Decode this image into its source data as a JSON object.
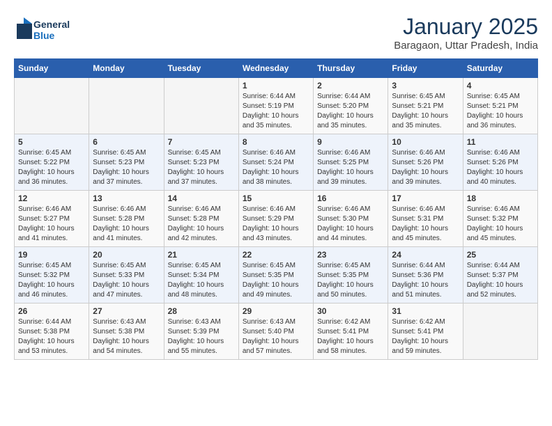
{
  "header": {
    "logo_line1": "General",
    "logo_line2": "Blue",
    "month": "January 2025",
    "location": "Baragaon, Uttar Pradesh, India"
  },
  "days_of_week": [
    "Sunday",
    "Monday",
    "Tuesday",
    "Wednesday",
    "Thursday",
    "Friday",
    "Saturday"
  ],
  "weeks": [
    [
      {
        "num": "",
        "info": ""
      },
      {
        "num": "",
        "info": ""
      },
      {
        "num": "",
        "info": ""
      },
      {
        "num": "1",
        "info": "Sunrise: 6:44 AM\nSunset: 5:19 PM\nDaylight: 10 hours\nand 35 minutes."
      },
      {
        "num": "2",
        "info": "Sunrise: 6:44 AM\nSunset: 5:20 PM\nDaylight: 10 hours\nand 35 minutes."
      },
      {
        "num": "3",
        "info": "Sunrise: 6:45 AM\nSunset: 5:21 PM\nDaylight: 10 hours\nand 35 minutes."
      },
      {
        "num": "4",
        "info": "Sunrise: 6:45 AM\nSunset: 5:21 PM\nDaylight: 10 hours\nand 36 minutes."
      }
    ],
    [
      {
        "num": "5",
        "info": "Sunrise: 6:45 AM\nSunset: 5:22 PM\nDaylight: 10 hours\nand 36 minutes."
      },
      {
        "num": "6",
        "info": "Sunrise: 6:45 AM\nSunset: 5:23 PM\nDaylight: 10 hours\nand 37 minutes."
      },
      {
        "num": "7",
        "info": "Sunrise: 6:45 AM\nSunset: 5:23 PM\nDaylight: 10 hours\nand 37 minutes."
      },
      {
        "num": "8",
        "info": "Sunrise: 6:46 AM\nSunset: 5:24 PM\nDaylight: 10 hours\nand 38 minutes."
      },
      {
        "num": "9",
        "info": "Sunrise: 6:46 AM\nSunset: 5:25 PM\nDaylight: 10 hours\nand 39 minutes."
      },
      {
        "num": "10",
        "info": "Sunrise: 6:46 AM\nSunset: 5:26 PM\nDaylight: 10 hours\nand 39 minutes."
      },
      {
        "num": "11",
        "info": "Sunrise: 6:46 AM\nSunset: 5:26 PM\nDaylight: 10 hours\nand 40 minutes."
      }
    ],
    [
      {
        "num": "12",
        "info": "Sunrise: 6:46 AM\nSunset: 5:27 PM\nDaylight: 10 hours\nand 41 minutes."
      },
      {
        "num": "13",
        "info": "Sunrise: 6:46 AM\nSunset: 5:28 PM\nDaylight: 10 hours\nand 41 minutes."
      },
      {
        "num": "14",
        "info": "Sunrise: 6:46 AM\nSunset: 5:28 PM\nDaylight: 10 hours\nand 42 minutes."
      },
      {
        "num": "15",
        "info": "Sunrise: 6:46 AM\nSunset: 5:29 PM\nDaylight: 10 hours\nand 43 minutes."
      },
      {
        "num": "16",
        "info": "Sunrise: 6:46 AM\nSunset: 5:30 PM\nDaylight: 10 hours\nand 44 minutes."
      },
      {
        "num": "17",
        "info": "Sunrise: 6:46 AM\nSunset: 5:31 PM\nDaylight: 10 hours\nand 45 minutes."
      },
      {
        "num": "18",
        "info": "Sunrise: 6:46 AM\nSunset: 5:32 PM\nDaylight: 10 hours\nand 45 minutes."
      }
    ],
    [
      {
        "num": "19",
        "info": "Sunrise: 6:45 AM\nSunset: 5:32 PM\nDaylight: 10 hours\nand 46 minutes."
      },
      {
        "num": "20",
        "info": "Sunrise: 6:45 AM\nSunset: 5:33 PM\nDaylight: 10 hours\nand 47 minutes."
      },
      {
        "num": "21",
        "info": "Sunrise: 6:45 AM\nSunset: 5:34 PM\nDaylight: 10 hours\nand 48 minutes."
      },
      {
        "num": "22",
        "info": "Sunrise: 6:45 AM\nSunset: 5:35 PM\nDaylight: 10 hours\nand 49 minutes."
      },
      {
        "num": "23",
        "info": "Sunrise: 6:45 AM\nSunset: 5:35 PM\nDaylight: 10 hours\nand 50 minutes."
      },
      {
        "num": "24",
        "info": "Sunrise: 6:44 AM\nSunset: 5:36 PM\nDaylight: 10 hours\nand 51 minutes."
      },
      {
        "num": "25",
        "info": "Sunrise: 6:44 AM\nSunset: 5:37 PM\nDaylight: 10 hours\nand 52 minutes."
      }
    ],
    [
      {
        "num": "26",
        "info": "Sunrise: 6:44 AM\nSunset: 5:38 PM\nDaylight: 10 hours\nand 53 minutes."
      },
      {
        "num": "27",
        "info": "Sunrise: 6:43 AM\nSunset: 5:38 PM\nDaylight: 10 hours\nand 54 minutes."
      },
      {
        "num": "28",
        "info": "Sunrise: 6:43 AM\nSunset: 5:39 PM\nDaylight: 10 hours\nand 55 minutes."
      },
      {
        "num": "29",
        "info": "Sunrise: 6:43 AM\nSunset: 5:40 PM\nDaylight: 10 hours\nand 57 minutes."
      },
      {
        "num": "30",
        "info": "Sunrise: 6:42 AM\nSunset: 5:41 PM\nDaylight: 10 hours\nand 58 minutes."
      },
      {
        "num": "31",
        "info": "Sunrise: 6:42 AM\nSunset: 5:41 PM\nDaylight: 10 hours\nand 59 minutes."
      },
      {
        "num": "",
        "info": ""
      }
    ]
  ]
}
